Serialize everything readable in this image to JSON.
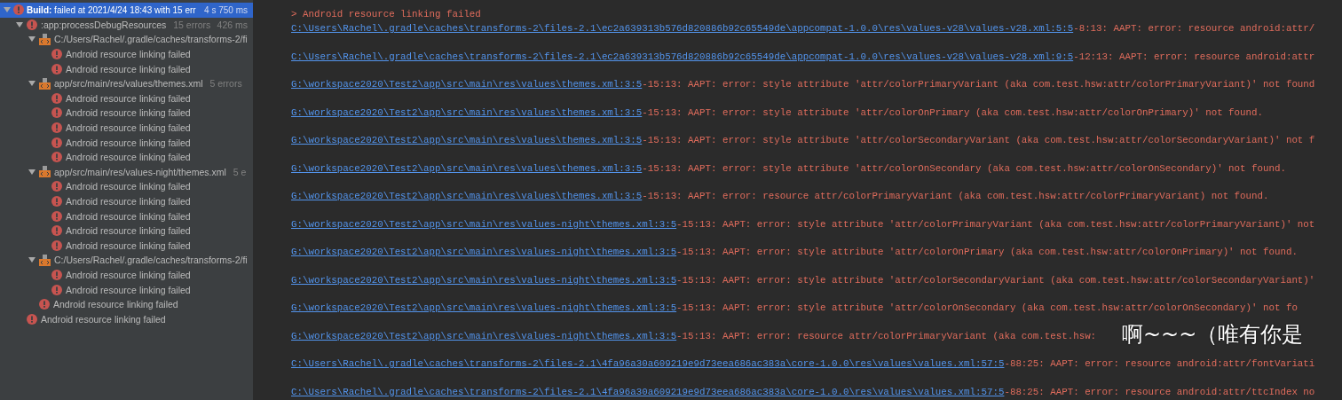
{
  "build_tree": {
    "label": "Build:",
    "text": "failed at 2021/4/24 18:43 with 15 err",
    "time": "4 s 750 ms",
    "selected": true,
    "expanded": true,
    "children": [
      {
        "label": ":app:processDebugResources",
        "count": "15 errors",
        "time": "426 ms",
        "expanded": true,
        "children": [
          {
            "kind": "file",
            "label": "C:/Users/Rachel/.gradle/caches/transforms-2/fi",
            "expanded": true,
            "children": [
              {
                "label": "Android resource linking failed"
              },
              {
                "label": "Android resource linking failed"
              }
            ]
          },
          {
            "kind": "file",
            "label": "app/src/main/res/values/themes.xml",
            "count": "5 errors",
            "expanded": true,
            "children": [
              {
                "label": "Android resource linking failed"
              },
              {
                "label": "Android resource linking failed"
              },
              {
                "label": "Android resource linking failed"
              },
              {
                "label": "Android resource linking failed"
              },
              {
                "label": "Android resource linking failed"
              }
            ]
          },
          {
            "kind": "file",
            "label": "app/src/main/res/values-night/themes.xml",
            "count": "5 e",
            "expanded": true,
            "children": [
              {
                "label": "Android resource linking failed"
              },
              {
                "label": "Android resource linking failed"
              },
              {
                "label": "Android resource linking failed"
              },
              {
                "label": "Android resource linking failed"
              },
              {
                "label": "Android resource linking failed"
              }
            ]
          },
          {
            "kind": "file",
            "label": "C:/Users/Rachel/.gradle/caches/transforms-2/fi",
            "expanded": true,
            "children": [
              {
                "label": "Android resource linking failed"
              },
              {
                "label": "Android resource linking failed"
              }
            ]
          },
          {
            "label": "Android resource linking failed"
          }
        ]
      },
      {
        "label": "Android resource linking failed"
      }
    ]
  },
  "console": {
    "heading": "> Android resource linking failed",
    "lines": [
      {
        "link": "C:\\Users\\Rachel\\.gradle\\caches\\transforms-2\\files-2.1\\ec2a639313b576d820886b92c65549de\\appcompat-1.0.0\\res\\values-v28\\values-v28.xml:5:5",
        "message": "-8:13: AAPT: error: resource android:attr/"
      },
      {
        "link": "C:\\Users\\Rachel\\.gradle\\caches\\transforms-2\\files-2.1\\ec2a639313b576d820886b92c65549de\\appcompat-1.0.0\\res\\values-v28\\values-v28.xml:9:5",
        "message": "-12:13: AAPT: error: resource android:attr"
      },
      {
        "link": "G:\\workspace2020\\Test2\\app\\src\\main\\res\\values\\themes.xml:3:5",
        "message": "-15:13: AAPT: error: style attribute 'attr/colorPrimaryVariant (aka com.test.hsw:attr/colorPrimaryVariant)' not found"
      },
      {
        "link": "G:\\workspace2020\\Test2\\app\\src\\main\\res\\values\\themes.xml:3:5",
        "message": "-15:13: AAPT: error: style attribute 'attr/colorOnPrimary (aka com.test.hsw:attr/colorOnPrimary)' not found."
      },
      {
        "link": "G:\\workspace2020\\Test2\\app\\src\\main\\res\\values\\themes.xml:3:5",
        "message": "-15:13: AAPT: error: style attribute 'attr/colorSecondaryVariant (aka com.test.hsw:attr/colorSecondaryVariant)' not f"
      },
      {
        "link": "G:\\workspace2020\\Test2\\app\\src\\main\\res\\values\\themes.xml:3:5",
        "message": "-15:13: AAPT: error: style attribute 'attr/colorOnSecondary (aka com.test.hsw:attr/colorOnSecondary)' not found."
      },
      {
        "link": "G:\\workspace2020\\Test2\\app\\src\\main\\res\\values\\themes.xml:3:5",
        "message": "-15:13: AAPT: error: resource attr/colorPrimaryVariant (aka com.test.hsw:attr/colorPrimaryVariant) not found."
      },
      {
        "link": "G:\\workspace2020\\Test2\\app\\src\\main\\res\\values-night\\themes.xml:3:5",
        "message": "-15:13: AAPT: error: style attribute 'attr/colorPrimaryVariant (aka com.test.hsw:attr/colorPrimaryVariant)' not"
      },
      {
        "link": "G:\\workspace2020\\Test2\\app\\src\\main\\res\\values-night\\themes.xml:3:5",
        "message": "-15:13: AAPT: error: style attribute 'attr/colorOnPrimary (aka com.test.hsw:attr/colorOnPrimary)' not found."
      },
      {
        "link": "G:\\workspace2020\\Test2\\app\\src\\main\\res\\values-night\\themes.xml:3:5",
        "message": "-15:13: AAPT: error: style attribute 'attr/colorSecondaryVariant (aka com.test.hsw:attr/colorSecondaryVariant)'"
      },
      {
        "link": "G:\\workspace2020\\Test2\\app\\src\\main\\res\\values-night\\themes.xml:3:5",
        "message": "-15:13: AAPT: error: style attribute 'attr/colorOnSecondary (aka com.test.hsw:attr/colorOnSecondary)' not fo"
      },
      {
        "link": "G:\\workspace2020\\Test2\\app\\src\\main\\res\\values-night\\themes.xml:3:5",
        "message": "-15:13: AAPT: error: resource attr/colorPrimaryVariant (aka com.test.hsw:",
        "overlay": "啊~~~（唯有你是"
      },
      {
        "link": "C:\\Users\\Rachel\\.gradle\\caches\\transforms-2\\files-2.1\\4fa96a30a609219e9d73eea686ac383a\\core-1.0.0\\res\\values\\values.xml:57:5",
        "message": "-88:25: AAPT: error: resource android:attr/fontVariati"
      },
      {
        "link": "C:\\Users\\Rachel\\.gradle\\caches\\transforms-2\\files-2.1\\4fa96a30a609219e9d73eea686ac383a\\core-1.0.0\\res\\values\\values.xml:57:5",
        "message": "-88:25: AAPT: error: resource android:attr/ttcIndex no"
      }
    ]
  }
}
